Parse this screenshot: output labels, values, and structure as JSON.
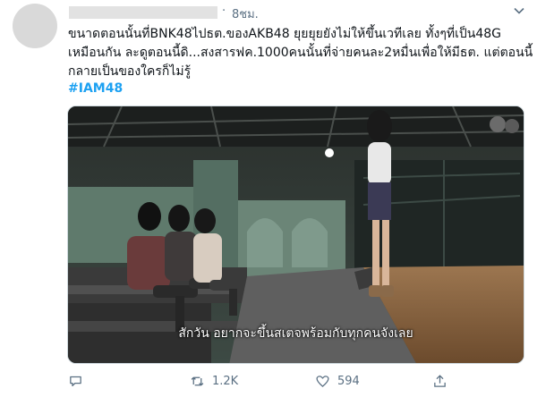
{
  "tweet": {
    "separator": "·",
    "time": "8ชม.",
    "lines": [
      "ขนาดตอนนั้นที่BNK48ไปธต.ของAKB48 ยุยยุยยังไม่ให้ขึ้นเวทีเลย ทั้งๆที่เป็น48G",
      "เหมือนกัน ละดูตอนนี้ดิ...สงสารฟค.1000คนนั้นที่จ่ายคนละ2หมื่นเพื่อให้มีธต. แต่ตอนนี้",
      "กลายเป็นของใครก็ไม่รู้"
    ],
    "hashtag": "#IAM48",
    "media": {
      "subtitle": "สักวัน  อยากจะขึ้นสเตจพร้อมกับทุกคนจังเลย"
    },
    "actions": {
      "retweets": "1.2K",
      "likes": "594"
    }
  },
  "icons": {
    "caret": "chevron-down-icon",
    "reply": "reply-icon",
    "retweet": "retweet-icon",
    "like": "heart-icon",
    "share": "share-icon"
  },
  "colors": {
    "link": "#1da1f2",
    "muted": "#5b7083",
    "text": "#0f1419"
  }
}
